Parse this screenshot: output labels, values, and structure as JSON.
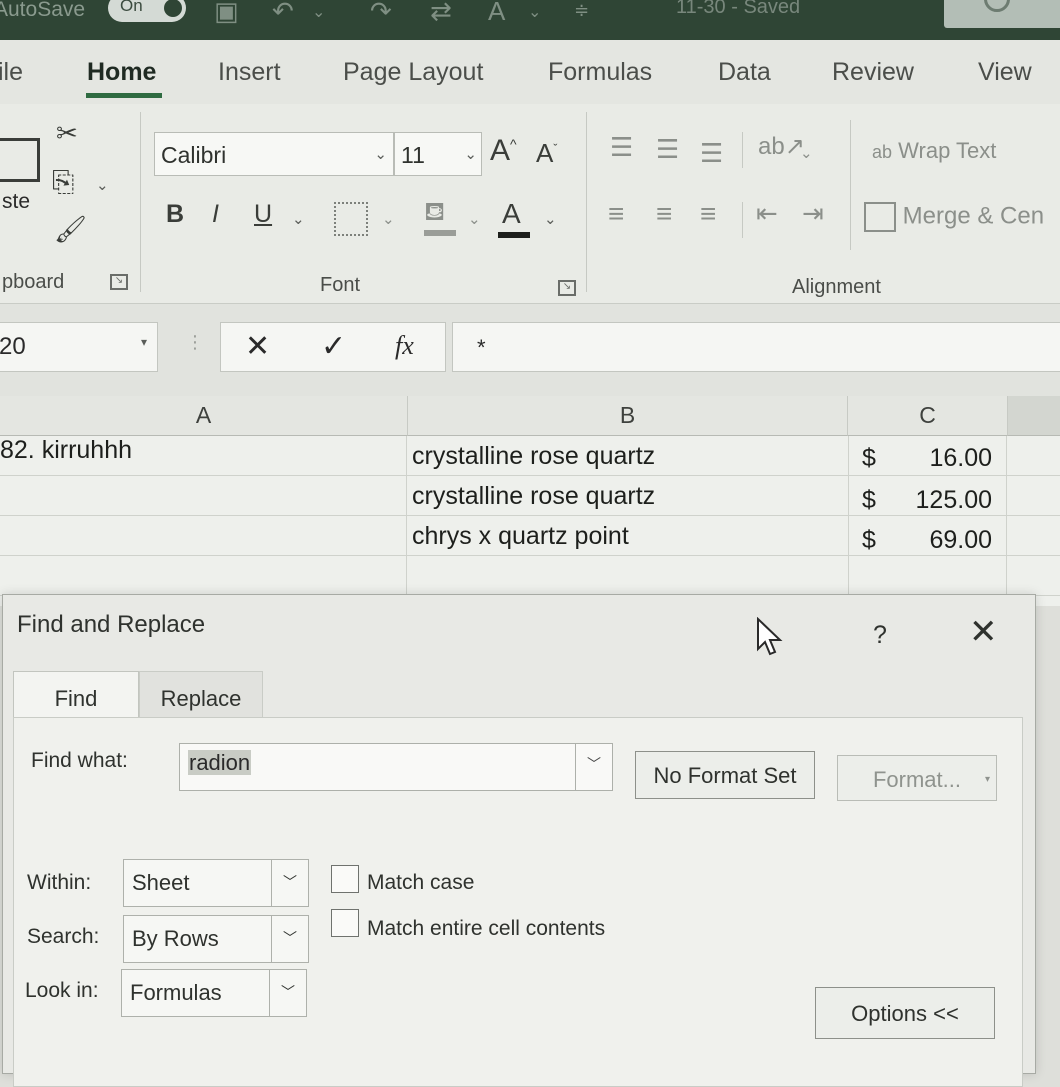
{
  "titlebar": {
    "autosave_label": "AutoSave",
    "toggle_state": "On",
    "font_color_letter": "A",
    "doc_status": "11-30 - Saved"
  },
  "tabs": [
    "ile",
    "Home",
    "Insert",
    "Page Layout",
    "Formulas",
    "Data",
    "Review",
    "View"
  ],
  "active_tab": "Home",
  "ribbon": {
    "clipboard": {
      "paste_label": "ste",
      "group_label": "pboard"
    },
    "font": {
      "family": "Calibri",
      "size": "11",
      "grow": "A",
      "shrink": "A",
      "bold": "B",
      "italic": "I",
      "underline": "U",
      "font_color": "A",
      "group_label": "Font"
    },
    "alignment": {
      "wrap_label": "Wrap Text",
      "wrap_glyph": "ab",
      "merge_label": "Merge & Cen",
      "group_label": "Alignment"
    }
  },
  "formula_bar": {
    "name_box": "20",
    "cancel": "✕",
    "enter": "✓",
    "fx": "fx",
    "content": "*"
  },
  "grid": {
    "columns": [
      "A",
      "B",
      "C"
    ],
    "rows": [
      {
        "a": "82. kirruhhh",
        "b": "crystalline rose quartz",
        "c_symbol": "$",
        "c_value": "16.00"
      },
      {
        "a": "",
        "b": "crystalline rose quartz",
        "c_symbol": "$",
        "c_value": "125.00"
      },
      {
        "a": "",
        "b": "chrys x quartz point",
        "c_symbol": "$",
        "c_value": "69.00"
      }
    ]
  },
  "dialog": {
    "title": "Find and Replace",
    "help": "?",
    "close": "✕",
    "tabs": [
      "Find",
      "Replace"
    ],
    "active_tab": "Find",
    "find_what_label": "Find what:",
    "find_what_value": "radion",
    "no_format_label": "No Format Set",
    "format_label": "Format...",
    "within_label": "Within:",
    "within_value": "Sheet",
    "search_label": "Search:",
    "search_value": "By Rows",
    "lookin_label": "Look in:",
    "lookin_value": "Formulas",
    "match_case_label": "Match case",
    "match_case_checked": false,
    "match_entire_label": "Match entire cell contents",
    "match_entire_checked": false,
    "options_label": "Options <<"
  },
  "colors": {
    "title_bar": "#2f4535",
    "accent_green": "#2f6b41",
    "ribbon_bg": "#e9ebe6"
  }
}
